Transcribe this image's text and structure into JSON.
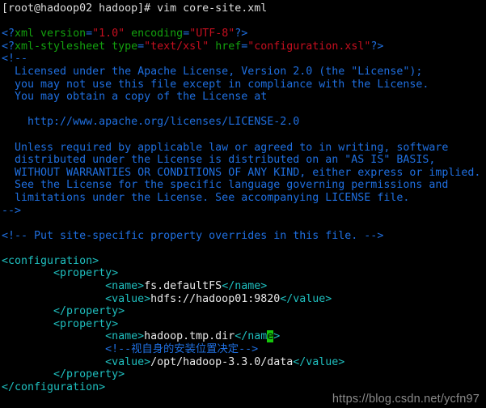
{
  "terminal": {
    "prompt_line": "[root@hadoop02 hadoop]# vim core-site.xml",
    "blank": ""
  },
  "xml": {
    "decl1": {
      "open": "<?",
      "name": "xml version",
      "eq1": "=",
      "val1": "\"1.0\"",
      "attr2": " encoding",
      "eq2": "=",
      "val2": "\"UTF-8\"",
      "close": "?>"
    },
    "decl2": {
      "open": "<?",
      "name": "xml-stylesheet type",
      "eq1": "=",
      "val1": "\"text/xsl\"",
      "attr2": " href",
      "eq2": "=",
      "val2": "\"configuration.xsl\"",
      "close": "?>"
    },
    "comment_open": "<!--",
    "license": [
      "  Licensed under the Apache License, Version 2.0 (the \"License\");",
      "  you may not use this file except in compliance with the License.",
      "  You may obtain a copy of the License at",
      "",
      "    http://www.apache.org/licenses/LICENSE-2.0",
      "",
      "  Unless required by applicable law or agreed to in writing, software",
      "  distributed under the License is distributed on an \"AS IS\" BASIS,",
      "  WITHOUT WARRANTIES OR CONDITIONS OF ANY KIND, either express or implied.",
      "  See the License for the specific language governing permissions and",
      "  limitations under the License. See accompanying LICENSE file."
    ],
    "comment_close": "-->",
    "site_comment": "<!-- Put site-specific property overrides in this file. -->",
    "configuration_open": "<configuration>",
    "configuration_close": "</configuration>",
    "property_open": "        <property>",
    "property_close": "        </property>",
    "prop1": {
      "name_tag_open": "                <name>",
      "name_text": "fs.defaultFS",
      "name_tag_close": "</name>",
      "value_tag_open": "                <value>",
      "value_text": "hdfs://hadoop01:9820",
      "value_tag_close": "</value>"
    },
    "prop2": {
      "name_tag_open": "                <name>",
      "name_text": "hadoop.tmp.dir",
      "name_tag_close_a": "</nam",
      "name_cursor_char": "e",
      "name_tag_close_b": ">",
      "inner_comment": "                <!--视自身的安装位置决定-->",
      "value_tag_open": "                <value>",
      "value_text": "/opt/hadoop-3.3.0/data",
      "value_tag_close": "</value>"
    }
  },
  "watermark": {
    "text": "https://blog.csdn.net/ycfn97"
  },
  "colors": {
    "background": "#000000",
    "prompt": "#dcdcdc",
    "comment_blue": "#1f6fe0",
    "attr_green": "#13a10e",
    "string_red": "#c50f1f",
    "tag_cyan": "#1fbfbf",
    "text_white": "#e8e8e8",
    "cursor_green": "#16c60c",
    "watermark_gray": "#8a8a8a"
  }
}
